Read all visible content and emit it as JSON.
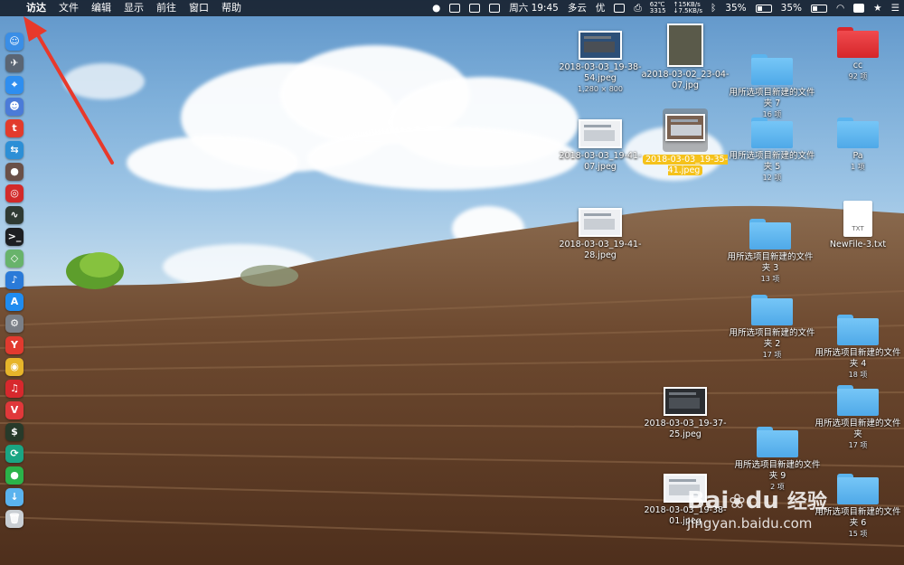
{
  "menubar": {
    "apple_symbol": "",
    "items": [
      "访达",
      "文件",
      "编辑",
      "显示",
      "前往",
      "窗口",
      "帮助"
    ],
    "temp": "62℃",
    "fan": "3315",
    "net_up": "↑15KB/s",
    "net_down": "↓7.5KB/s",
    "clock": "周六 19:45",
    "weather": "多云",
    "quality": "优",
    "battery_left": "35%",
    "battery_right": "35%"
  },
  "dock": {
    "icons": [
      {
        "name": "finder-icon",
        "color": "#3a8ee6",
        "glyph": "☺"
      },
      {
        "name": "launchpad-icon",
        "color": "#5a6573",
        "glyph": "✈"
      },
      {
        "name": "safari-icon",
        "color": "#2e8ef0",
        "glyph": "⌖"
      },
      {
        "name": "contacts-icon",
        "color": "#4b7bd8",
        "glyph": "☻"
      },
      {
        "name": "app-store-red-icon",
        "color": "#e23b2c",
        "glyph": "t"
      },
      {
        "name": "migration-icon",
        "color": "#2c8fd6",
        "glyph": "⇆"
      },
      {
        "name": "basketball-icon",
        "color": "#6a5048",
        "glyph": "●"
      },
      {
        "name": "netease-icon",
        "color": "#d22a2a",
        "glyph": "◎"
      },
      {
        "name": "activity-monitor-icon",
        "color": "#2f3a33",
        "glyph": "∿"
      },
      {
        "name": "terminal-icon",
        "color": "#1d1f22",
        "glyph": ">_"
      },
      {
        "name": "maps-icon",
        "color": "#68b36b",
        "glyph": "◇"
      },
      {
        "name": "mic-icon",
        "color": "#2a7ad8",
        "glyph": "♪"
      },
      {
        "name": "app-store-icon",
        "color": "#1f8cf0",
        "glyph": "A"
      },
      {
        "name": "system-preferences-icon",
        "color": "#7a7f87",
        "glyph": "⚙"
      },
      {
        "name": "yandex-icon",
        "color": "#e23a2f",
        "glyph": "Y"
      },
      {
        "name": "chrome-icon",
        "color": "#e7b52a",
        "glyph": "◉"
      },
      {
        "name": "music-icon",
        "color": "#d7282d",
        "glyph": "♫"
      },
      {
        "name": "vivaldi-icon",
        "color": "#e0383a",
        "glyph": "V"
      },
      {
        "name": "console-icon",
        "color": "#273a2a",
        "glyph": "$"
      },
      {
        "name": "sync-icon",
        "color": "#1aa583",
        "glyph": "⟳"
      },
      {
        "name": "wechat-icon",
        "color": "#2bb34a",
        "glyph": "●"
      },
      {
        "name": "downloads-folder-icon",
        "color": "#5ab3ee",
        "glyph": "↓"
      },
      {
        "name": "trash-icon",
        "color": "#c9ced3",
        "glyph": "🗑"
      }
    ]
  },
  "desktop": {
    "items": [
      {
        "id": "img1",
        "label": "2018-03-03_19-38-54.jpeg",
        "sub": "1,280 × 800"
      },
      {
        "id": "img2",
        "label": "a2018-03-02_23-04-07.jpg",
        "sub": ""
      },
      {
        "id": "img3",
        "label": "2018-03-03_19-41-07.jpeg",
        "sub": ""
      },
      {
        "id": "img4",
        "label": "2018-03-03_19-35-41.jpeg",
        "sub": ""
      },
      {
        "id": "img5",
        "label": "2018-03-03_19-41-28.jpeg",
        "sub": ""
      },
      {
        "id": "img6",
        "label": "2018-03-03_19-37-25.jpeg",
        "sub": ""
      },
      {
        "id": "img7",
        "label": "2018-03-03_19-38-01.jpeg",
        "sub": ""
      },
      {
        "id": "f7",
        "label": "用所选项目新建的文件夹 7",
        "sub": "16 项"
      },
      {
        "id": "f5",
        "label": "用所选项目新建的文件夹 5",
        "sub": "12 项"
      },
      {
        "id": "f3",
        "label": "用所选项目新建的文件夹 3",
        "sub": "13 项"
      },
      {
        "id": "f2",
        "label": "用所选项目新建的文件夹 2",
        "sub": "17 项"
      },
      {
        "id": "f9",
        "label": "用所选项目新建的文件夹 9",
        "sub": "2 项"
      },
      {
        "id": "cc",
        "label": "cc",
        "sub": "92 项"
      },
      {
        "id": "pa",
        "label": "Pa",
        "sub": "1 项"
      },
      {
        "id": "txt",
        "label": "NewFile-3.txt",
        "sub": ""
      },
      {
        "id": "f4",
        "label": "用所选项目新建的文件夹 4",
        "sub": "18 项"
      },
      {
        "id": "f0",
        "label": "用所选项目新建的文件夹",
        "sub": "17 项"
      },
      {
        "id": "f6",
        "label": "用所选项目新建的文件夹 6",
        "sub": "15 项"
      }
    ],
    "txt_badge": "TXT"
  },
  "watermark": {
    "brand": "Bai",
    "paw": "du",
    "cn": "经验",
    "url": "jingyan.baidu.com"
  },
  "annotation_arrow_color": "#e8392b"
}
